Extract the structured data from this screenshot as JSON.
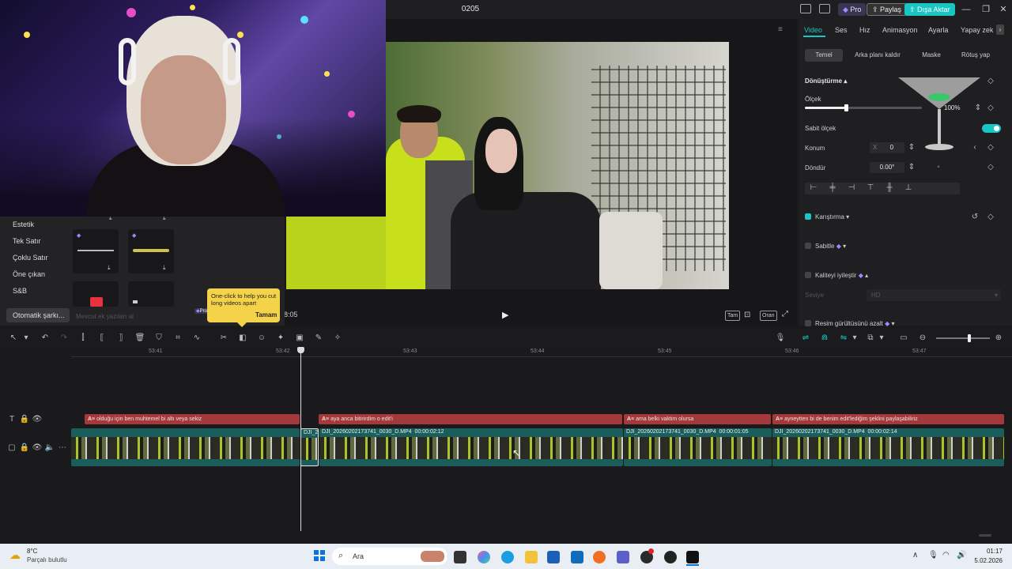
{
  "window": {
    "title": "0205",
    "pro_label": "Pro",
    "share_label": "Paylaş",
    "export_label": "Dışa Aktar"
  },
  "left_panel": {
    "categories": [
      "Estetik",
      "Tek Satır",
      "Çoklu Satır",
      "Öne çıkan",
      "S&B",
      "Otomatik şarkı..."
    ],
    "hidden_item": "Mevcut ek yazıları al",
    "pro_badge": "Pro"
  },
  "tooltip": {
    "text": "One-click to help you cut long videos apart",
    "button": "Tamam"
  },
  "player": {
    "time": "28:05",
    "buttons": [
      "Tam",
      "Oran"
    ]
  },
  "right_panel": {
    "tabs": [
      "Video",
      "Ses",
      "Hız",
      "Animasyon",
      "Ayarla",
      "Yapay zek"
    ],
    "subtabs": [
      "Temel",
      "Arka planı kaldır",
      "Maske",
      "Rötuş yap"
    ],
    "transform": {
      "title": "Dönüştürme",
      "scale_label": "Ölçek",
      "scale_value": "100%",
      "scale_level": 0.35,
      "fixed_scale_label": "Sabit ölçek",
      "position_label": "Konum",
      "position_x_prefix": "X",
      "position_x": "0",
      "rotate_label": "Döndür",
      "rotate_value": "0.00°"
    },
    "sections": [
      {
        "label": "Karıştırma",
        "checked": true
      },
      {
        "label": "Sabitle",
        "checked": false
      },
      {
        "label": "Kaliteyi iyileştir",
        "checked": false
      },
      {
        "label": "Resim gürültüsünü azalt",
        "checked": false
      }
    ],
    "quality_row": {
      "label": "Seviye",
      "value": "HD"
    }
  },
  "timeline": {
    "ticks": [
      "53:41",
      "53:42",
      "53:43",
      "53:44",
      "53:45",
      "53:46",
      "53:47"
    ],
    "text_clips": [
      "olduğu için ben muhtemel bi altı veya sekiz",
      "aya anca bitirirdim o edit'i",
      "ama belki vaktim olursa",
      "ayneytten bi de benim edit'lediğim şeklini paylaşabiliriz"
    ],
    "video_clips": [
      {
        "name": "",
        "duration": ""
      },
      {
        "name": "DJI_2",
        "duration": ""
      },
      {
        "name": "DJI_20260202173741_0030_D.MP4",
        "duration": "00:00:02:12"
      },
      {
        "name": "DJI_20260202173741_0030_D.MP4",
        "duration": "00:00:01:05"
      },
      {
        "name": "DJI_20260202173741_0030_D.MP4",
        "duration": "00:00:02:14"
      }
    ]
  },
  "taskbar": {
    "weather_temp": "8°C",
    "weather_desc": "Parçalı bulutlu",
    "search_label": "Ara",
    "time": "01:17",
    "date": "5.02.2026"
  },
  "colors": {
    "accent": "#19c6c3",
    "clip_text": "#a3393b",
    "clip_video": "#1b5d5a",
    "pro": "#7a6cf0"
  }
}
